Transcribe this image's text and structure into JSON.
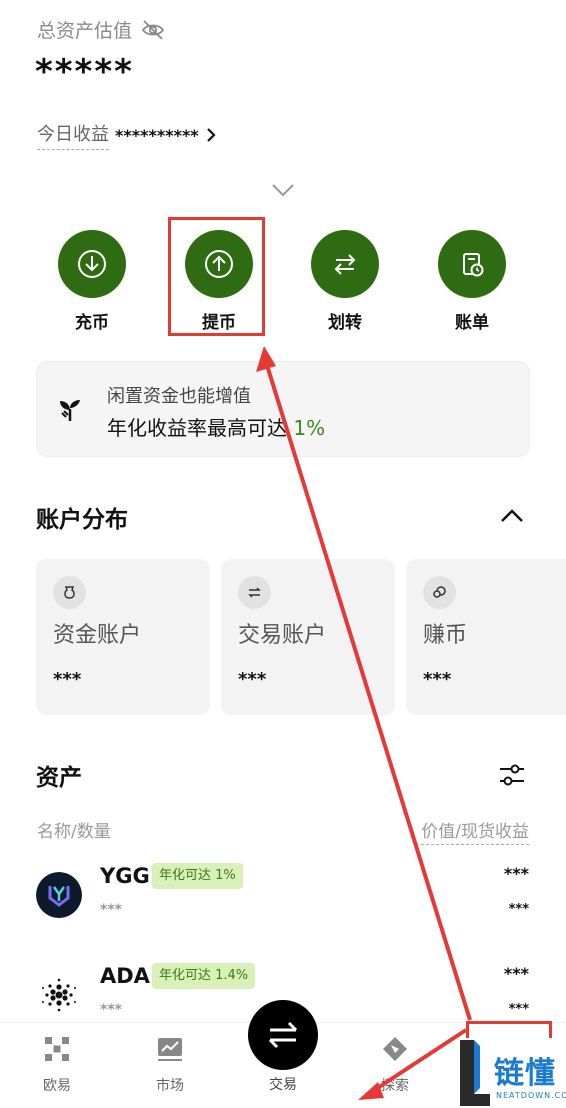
{
  "header": {
    "total_label": "总资产估值",
    "masked_total": "*****",
    "today_label": "今日收益",
    "today_value": "**********"
  },
  "actions": [
    {
      "label": "充币",
      "icon": "download-icon"
    },
    {
      "label": "提币",
      "icon": "upload-icon"
    },
    {
      "label": "划转",
      "icon": "transfer-icon"
    },
    {
      "label": "账单",
      "icon": "bill-icon"
    }
  ],
  "promo": {
    "line1": "闲置资金也能增值",
    "line2_prefix": "年化收益率最高可达 ",
    "line2_rate": "1%"
  },
  "account_section": {
    "title": "账户分布",
    "cards": [
      {
        "name": "资金账户",
        "value": "***",
        "icon": "wallet-icon"
      },
      {
        "name": "交易账户",
        "value": "***",
        "icon": "exchange-icon"
      },
      {
        "name": "赚币",
        "value": "***",
        "icon": "coins-icon"
      }
    ]
  },
  "assets_section": {
    "title": "资产",
    "col_left": "名称/数量",
    "col_right": "价值/现货收益",
    "rows": [
      {
        "symbol": "YGG",
        "badge": "年化可达 1%",
        "amount": "***",
        "value": "***",
        "profit": "***"
      },
      {
        "symbol": "ADA",
        "badge": "年化可达 1.4%",
        "amount": "***",
        "value": "***",
        "profit": "***"
      }
    ]
  },
  "bottom_nav": {
    "items": [
      "欧易",
      "市场",
      "交易",
      "探索"
    ]
  },
  "watermark": {
    "brand": "链懂",
    "url": "NEATDOWN.COM"
  },
  "colors": {
    "accent_green": "#2f6b12",
    "annotation_red": "#e53935"
  }
}
